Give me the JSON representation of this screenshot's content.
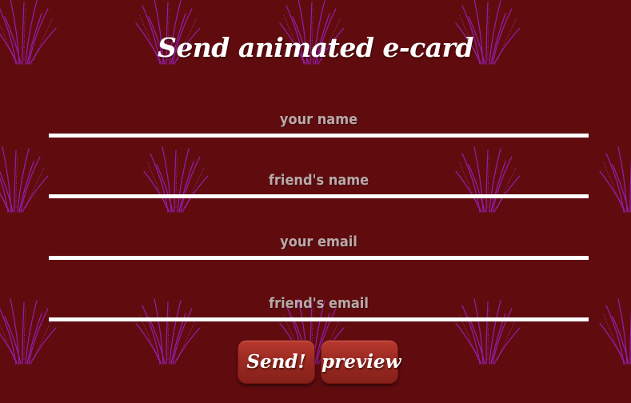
{
  "page": {
    "title": "Send animated e-card"
  },
  "form": {
    "your_name": {
      "placeholder": "your name",
      "value": ""
    },
    "friends_name": {
      "placeholder": "friend's name",
      "value": ""
    },
    "your_email": {
      "placeholder": "your email",
      "value": ""
    },
    "friends_email": {
      "placeholder": "friend's email",
      "value": ""
    }
  },
  "buttons": {
    "send_label": "Send!",
    "preview_label": "preview"
  },
  "colors": {
    "background": "#600c0f",
    "pattern": "#a020c8",
    "text": "#ffffff",
    "placeholder": "#b9a9a9",
    "button": "#9c2a22"
  }
}
